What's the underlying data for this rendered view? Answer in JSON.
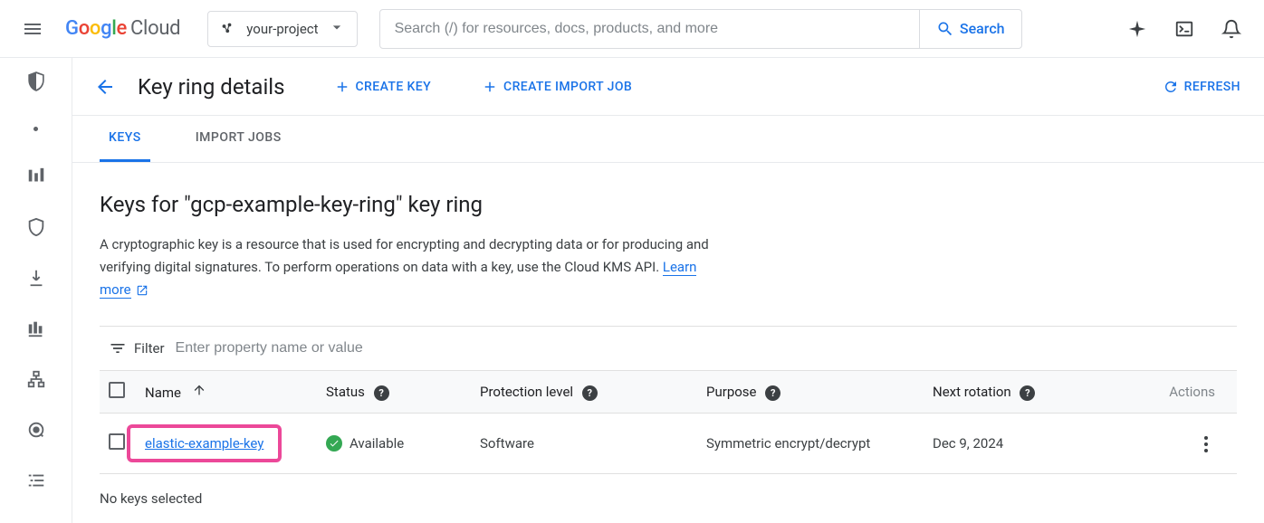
{
  "header": {
    "logo_cloud": "Cloud",
    "project_name": "your-project",
    "search_placeholder": "Search (/) for resources, docs, products, and more",
    "search_button": "Search"
  },
  "page": {
    "title": "Key ring details",
    "create_key": "CREATE KEY",
    "create_import_job": "CREATE IMPORT JOB",
    "refresh": "REFRESH"
  },
  "tabs": {
    "keys": "KEYS",
    "import_jobs": "IMPORT JOBS"
  },
  "section": {
    "title": "Keys for \"gcp-example-key-ring\" key ring",
    "desc": "A cryptographic key is a resource that is used for encrypting and decrypting data or for producing and verifying digital signatures. To perform operations on data with a key, use the Cloud KMS API. ",
    "learn_more": "Learn more"
  },
  "filter": {
    "label": "Filter",
    "placeholder": "Enter property name or value"
  },
  "table": {
    "columns": {
      "name": "Name",
      "status": "Status",
      "protection": "Protection level",
      "purpose": "Purpose",
      "rotation": "Next rotation",
      "actions": "Actions"
    },
    "rows": [
      {
        "name": "elastic-example-key",
        "status": "Available",
        "protection": "Software",
        "purpose": "Symmetric encrypt/decrypt",
        "rotation": "Dec 9, 2024"
      }
    ]
  },
  "footer": {
    "note": "No keys selected"
  }
}
